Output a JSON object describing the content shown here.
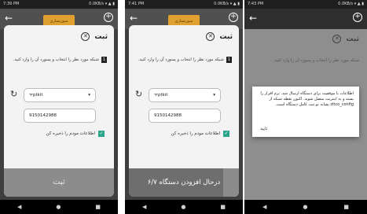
{
  "phones": [
    {
      "status": {
        "time": "7:39 PM",
        "right": "0.0KB/s ▾ ▲ ▮"
      },
      "logo_text": "سوزنساری",
      "sheet": {
        "title": "ثبت",
        "step_number": "1",
        "step_text": "شبکه مورد نظر را انتخاب و پسورد آن را وارد کنید.",
        "wifi_value": "ptkit",
        "password_value": "9150142988",
        "save_label": "اطلاعات مودم را ذخیره کن",
        "submit_label": "ثبت"
      }
    },
    {
      "status": {
        "time": "7:41 PM",
        "right": "0.0KB/s ▾ ▲ ▮"
      },
      "logo_text": "سوزنساری",
      "sheet": {
        "title": "ثبت",
        "step_number": "1",
        "step_text": "شبکه مورد نظر را انتخاب و پسورد آن را وارد کنید.",
        "wifi_value": "ptkit",
        "password_value": "9150142988",
        "save_label": "اطلاعات مودم را ذخیره کن",
        "progress_label": "درحال افزودن دستگاه ۶/۷",
        "progress_fraction": 0.857
      }
    },
    {
      "status": {
        "time": "7:43 PM",
        "right": "0.0KB/s ▾ ▲ ▮"
      },
      "title": "ثبت",
      "step_text": "شبکه مورد نظر را انتخاب و پسورد آن را وارد کنید.",
      "dialog": {
        "message": "اطلاعات با موفقیت برای دستگاه ارسال شد. نرم افزار را بسته و به اینترنت متصل شوید. اکنون نقطه شبکه از zitco_config نشانه تو ثبت کامل دستگاه است.",
        "ok_label": "تایید"
      }
    }
  ]
}
